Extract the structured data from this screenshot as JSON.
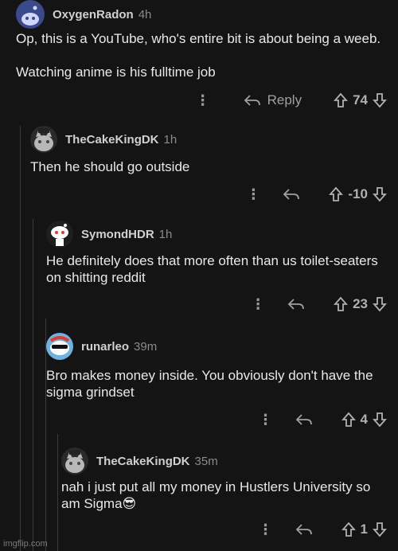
{
  "comments": [
    {
      "user": "OxygenRadon",
      "time": "4h",
      "text": "Op, this is a YouTube, who's entire bit is about being a weeb.\n\nWatching anime is his fulltime job",
      "reply_label": "Reply",
      "score": "74",
      "avatar_icon": "snoo-avatar-icon"
    },
    {
      "user": "TheCakeKingDK",
      "time": "1h",
      "text": "Then he should go outside",
      "score": "-10",
      "avatar_icon": "cat-avatar-icon"
    },
    {
      "user": "SymondHDR",
      "time": "1h",
      "text": "He definitely does that more often than us toilet-seaters\non shitting reddit",
      "score": "23",
      "avatar_icon": "snoo-avatar-icon"
    },
    {
      "user": "runarleo",
      "time": "39m",
      "text": "Bro makes money inside. You obviously don't have the\nsigma grindset",
      "score": "4",
      "avatar_icon": "sunglasses-avatar-icon"
    },
    {
      "user": "TheCakeKingDK",
      "time": "35m",
      "text": "nah i just put all my money in Hustlers University so\nam Sigma😎",
      "score": "1",
      "avatar_icon": "cat-avatar-icon"
    }
  ],
  "watermark": "imgflip.com",
  "colors": {
    "background": "#141414",
    "text": "#e8e8e8",
    "muted": "#9a9a9a",
    "line": "#3a3a3a"
  }
}
